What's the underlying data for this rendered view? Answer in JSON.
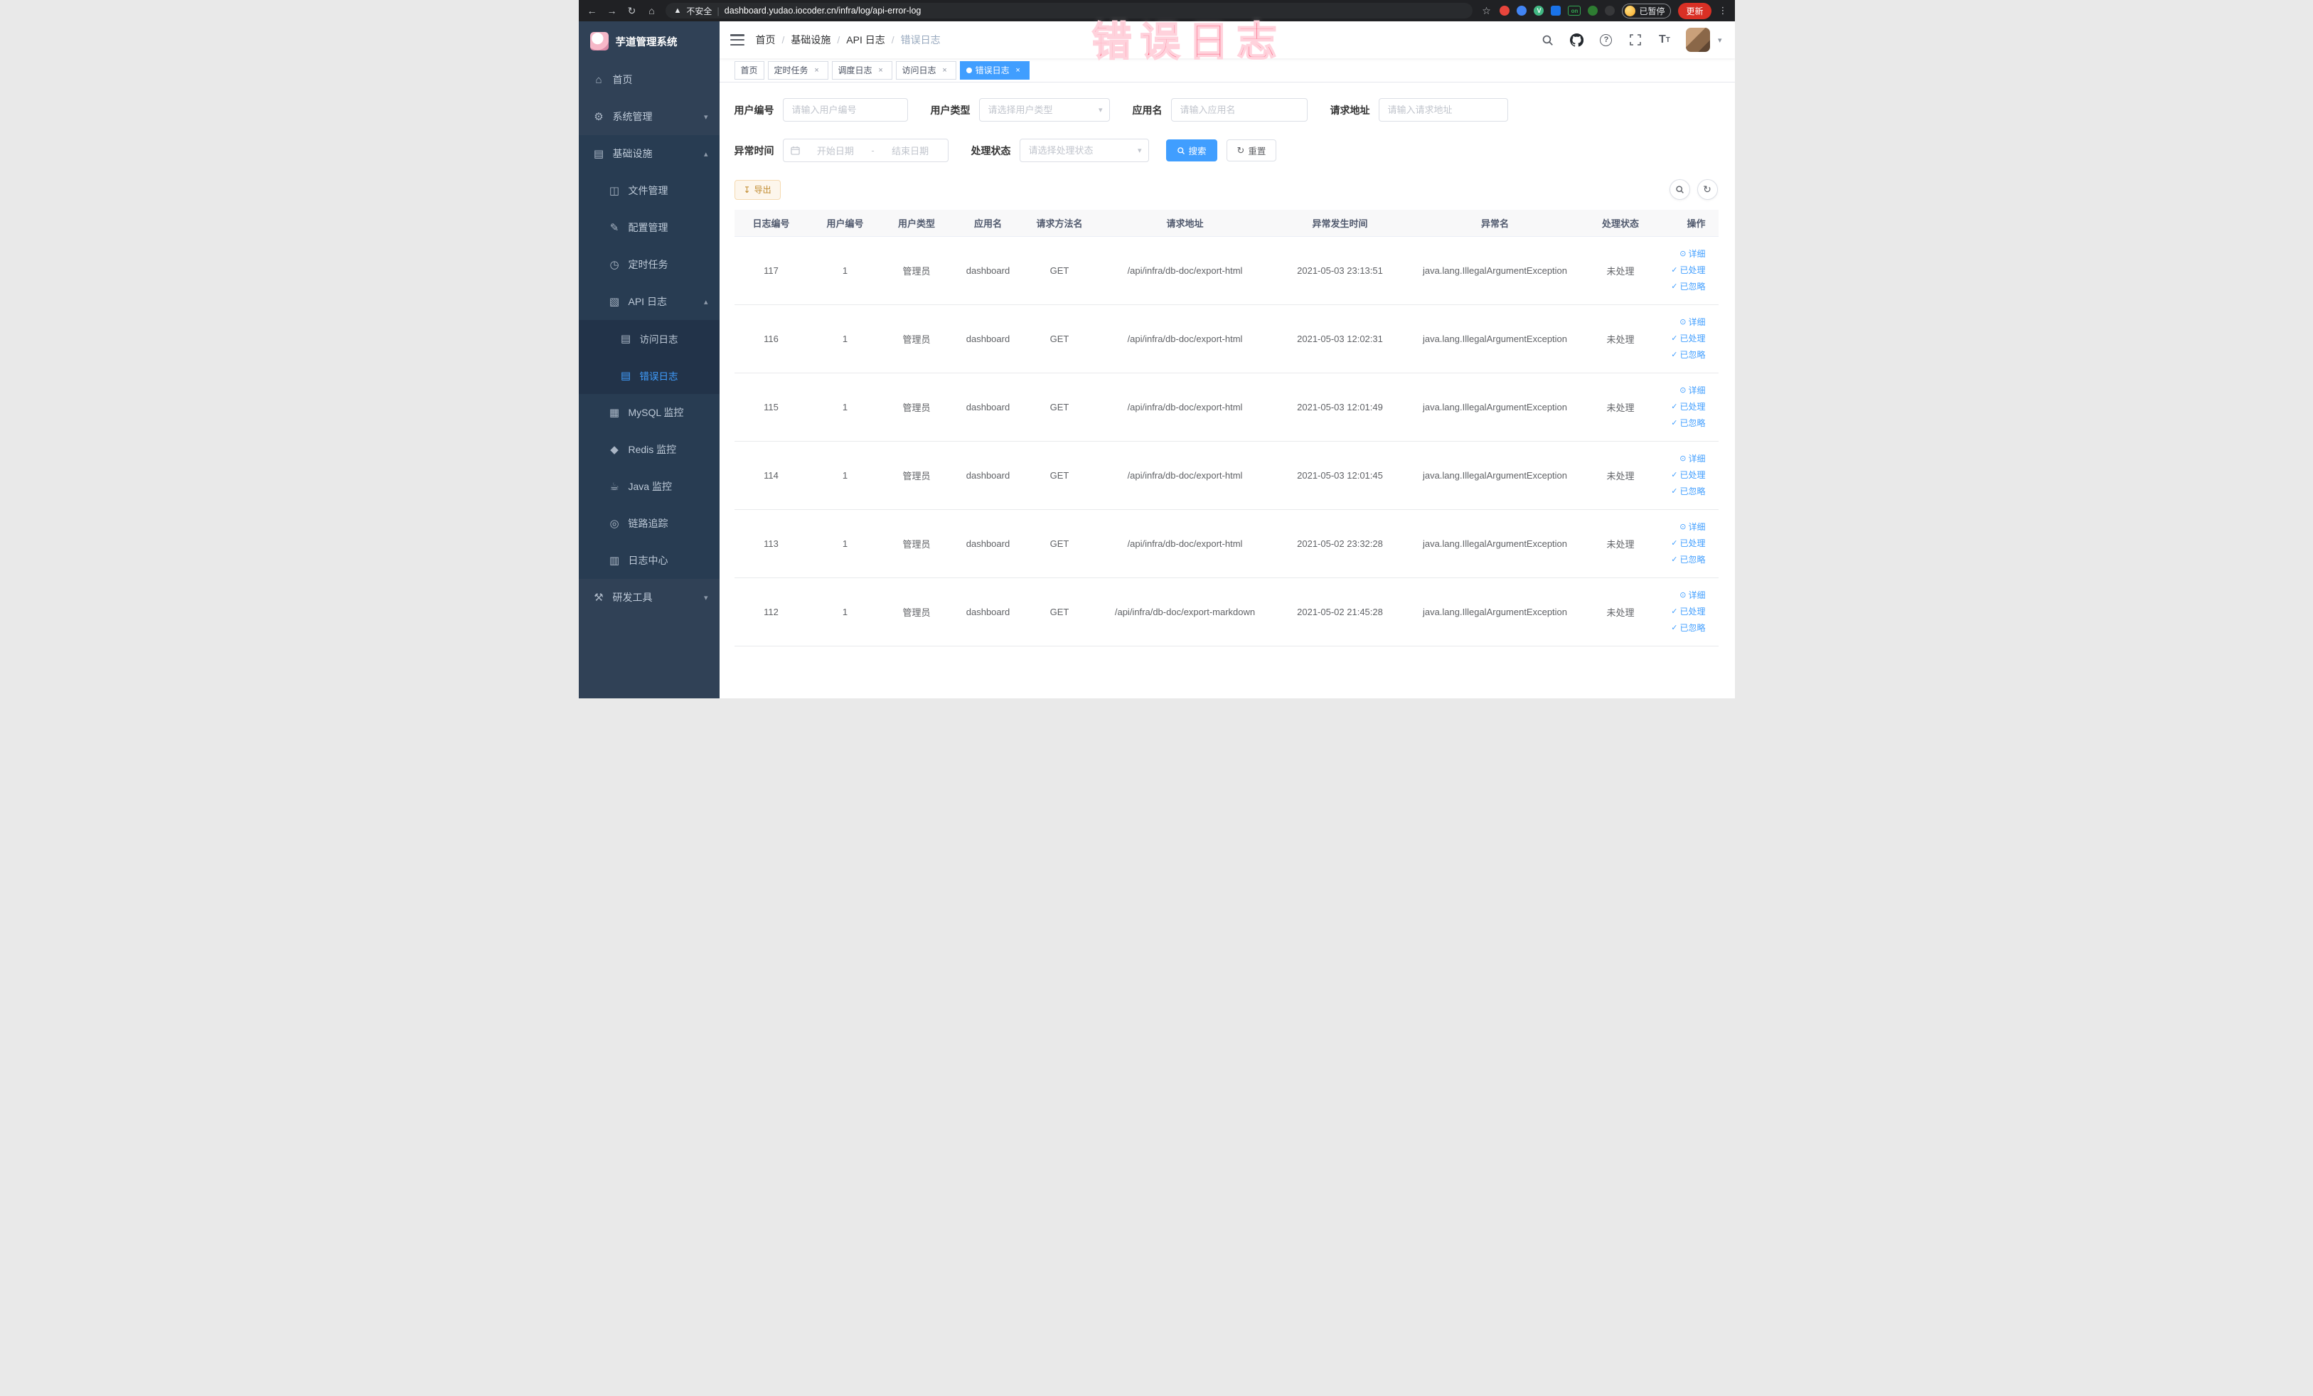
{
  "browser": {
    "security_label": "不安全",
    "url": "dashboard.yudao.iocoder.cn/infra/log/api-error-log",
    "extension_on_label": "on",
    "paused_badge": "已暂停",
    "update_label": "更新"
  },
  "annotation": {
    "text": "错误日志"
  },
  "sidebar": {
    "app_title": "芋道管理系统",
    "items": {
      "home": "首页",
      "system": "系统管理",
      "infra": "基础设施",
      "file": "文件管理",
      "config": "配置管理",
      "job": "定时任务",
      "api_log": "API 日志",
      "access_log": "访问日志",
      "error_log": "错误日志",
      "mysql": "MySQL 监控",
      "redis": "Redis 监控",
      "java": "Java 监控",
      "trace": "链路追踪",
      "log_center": "日志中心",
      "dev_tools": "研发工具"
    }
  },
  "navbar": {
    "breadcrumb": [
      "首页",
      "基础设施",
      "API 日志",
      "错误日志"
    ]
  },
  "tags": [
    {
      "label": "首页"
    },
    {
      "label": "定时任务"
    },
    {
      "label": "调度日志"
    },
    {
      "label": "访问日志"
    },
    {
      "label": "错误日志"
    }
  ],
  "filters": {
    "user_id": {
      "label": "用户编号",
      "placeholder": "请输入用户编号"
    },
    "user_type": {
      "label": "用户类型",
      "placeholder": "请选择用户类型"
    },
    "app_name": {
      "label": "应用名",
      "placeholder": "请输入应用名"
    },
    "request_url": {
      "label": "请求地址",
      "placeholder": "请输入请求地址"
    },
    "exception_time": {
      "label": "异常时间",
      "start_placeholder": "开始日期",
      "separator": "-",
      "end_placeholder": "结束日期"
    },
    "process_status": {
      "label": "处理状态",
      "placeholder": "请选择处理状态"
    },
    "search_label": "搜索",
    "reset_label": "重置"
  },
  "toolbar": {
    "export_label": "导出"
  },
  "table": {
    "columns": [
      "日志编号",
      "用户编号",
      "用户类型",
      "应用名",
      "请求方法名",
      "请求地址",
      "异常发生时间",
      "异常名",
      "处理状态",
      "操作"
    ],
    "actions": {
      "detail": "详细",
      "processed": "已处理",
      "ignored": "已忽略"
    },
    "rows": [
      {
        "id": "117",
        "user_id": "1",
        "user_type": "管理员",
        "app": "dashboard",
        "method": "GET",
        "url": "/api/infra/db-doc/export-html",
        "time": "2021-05-03 23:13:51",
        "exception": "java.lang.IllegalArgumentException",
        "status": "未处理"
      },
      {
        "id": "116",
        "user_id": "1",
        "user_type": "管理员",
        "app": "dashboard",
        "method": "GET",
        "url": "/api/infra/db-doc/export-html",
        "time": "2021-05-03 12:02:31",
        "exception": "java.lang.IllegalArgumentException",
        "status": "未处理"
      },
      {
        "id": "115",
        "user_id": "1",
        "user_type": "管理员",
        "app": "dashboard",
        "method": "GET",
        "url": "/api/infra/db-doc/export-html",
        "time": "2021-05-03 12:01:49",
        "exception": "java.lang.IllegalArgumentException",
        "status": "未处理"
      },
      {
        "id": "114",
        "user_id": "1",
        "user_type": "管理员",
        "app": "dashboard",
        "method": "GET",
        "url": "/api/infra/db-doc/export-html",
        "time": "2021-05-03 12:01:45",
        "exception": "java.lang.IllegalArgumentException",
        "status": "未处理"
      },
      {
        "id": "113",
        "user_id": "1",
        "user_type": "管理员",
        "app": "dashboard",
        "method": "GET",
        "url": "/api/infra/db-doc/export-html",
        "time": "2021-05-02 23:32:28",
        "exception": "java.lang.IllegalArgumentException",
        "status": "未处理"
      },
      {
        "id": "112",
        "user_id": "1",
        "user_type": "管理员",
        "app": "dashboard",
        "method": "GET",
        "url": "/api/infra/db-doc/export-markdown",
        "time": "2021-05-02 21:45:28",
        "exception": "java.lang.IllegalArgumentException",
        "status": "未处理"
      }
    ]
  }
}
